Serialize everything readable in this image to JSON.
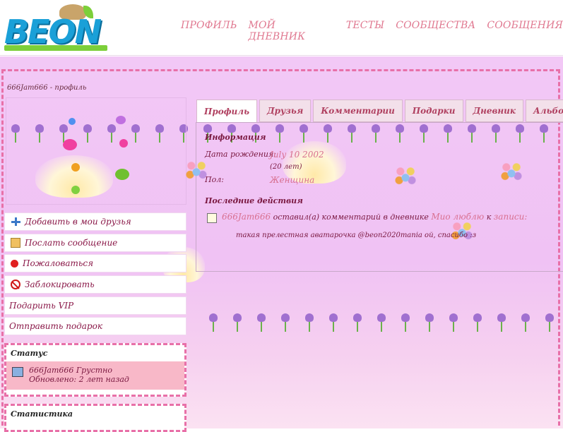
{
  "header": {
    "logo_text": "BEON",
    "nav": [
      "ПРОФИЛЬ",
      "МОЙ ДНЕВНИК",
      "ТЕСТЫ",
      "СООБЩЕСТВА",
      "СООБЩЕНИЯ"
    ]
  },
  "page_title": "666Jam666 - профиль",
  "actions": {
    "add_friend": "Добавить в мои друзья",
    "send_message": "Послать сообщение",
    "complain": "Пожаловаться",
    "block": "Заблокировать",
    "gift_vip": "Подарить VIP",
    "send_gift": "Отправить подарок"
  },
  "status": {
    "title": "Статус",
    "text": "666Jam666 Грустно",
    "updated": "Обновлено: 2 лет назад"
  },
  "stats": {
    "title": "Статистика"
  },
  "tabs": [
    "Профиль",
    "Друзья",
    "Комментарии",
    "Подарки",
    "Дневник",
    "Альбомы"
  ],
  "info": {
    "title": "Информация",
    "birth_label": "Дата рождения:",
    "birth_value": "July 10 2002",
    "age": "(20 лет)",
    "gender_label": "Пол:",
    "gender_value": "Женщина"
  },
  "recent": {
    "title": "Последние действия",
    "user": "666Jam666",
    "action_text": "оставил(а) комментарий в дневнике",
    "diary": "Мио люблю",
    "to": "к",
    "entry": "записи:",
    "comment": "такая прелестная аватарочка @beon2020mania ой, спасибо :з"
  },
  "colors": {
    "accent": "#e870a8",
    "link": "#d87090",
    "text": "#7a1840"
  }
}
